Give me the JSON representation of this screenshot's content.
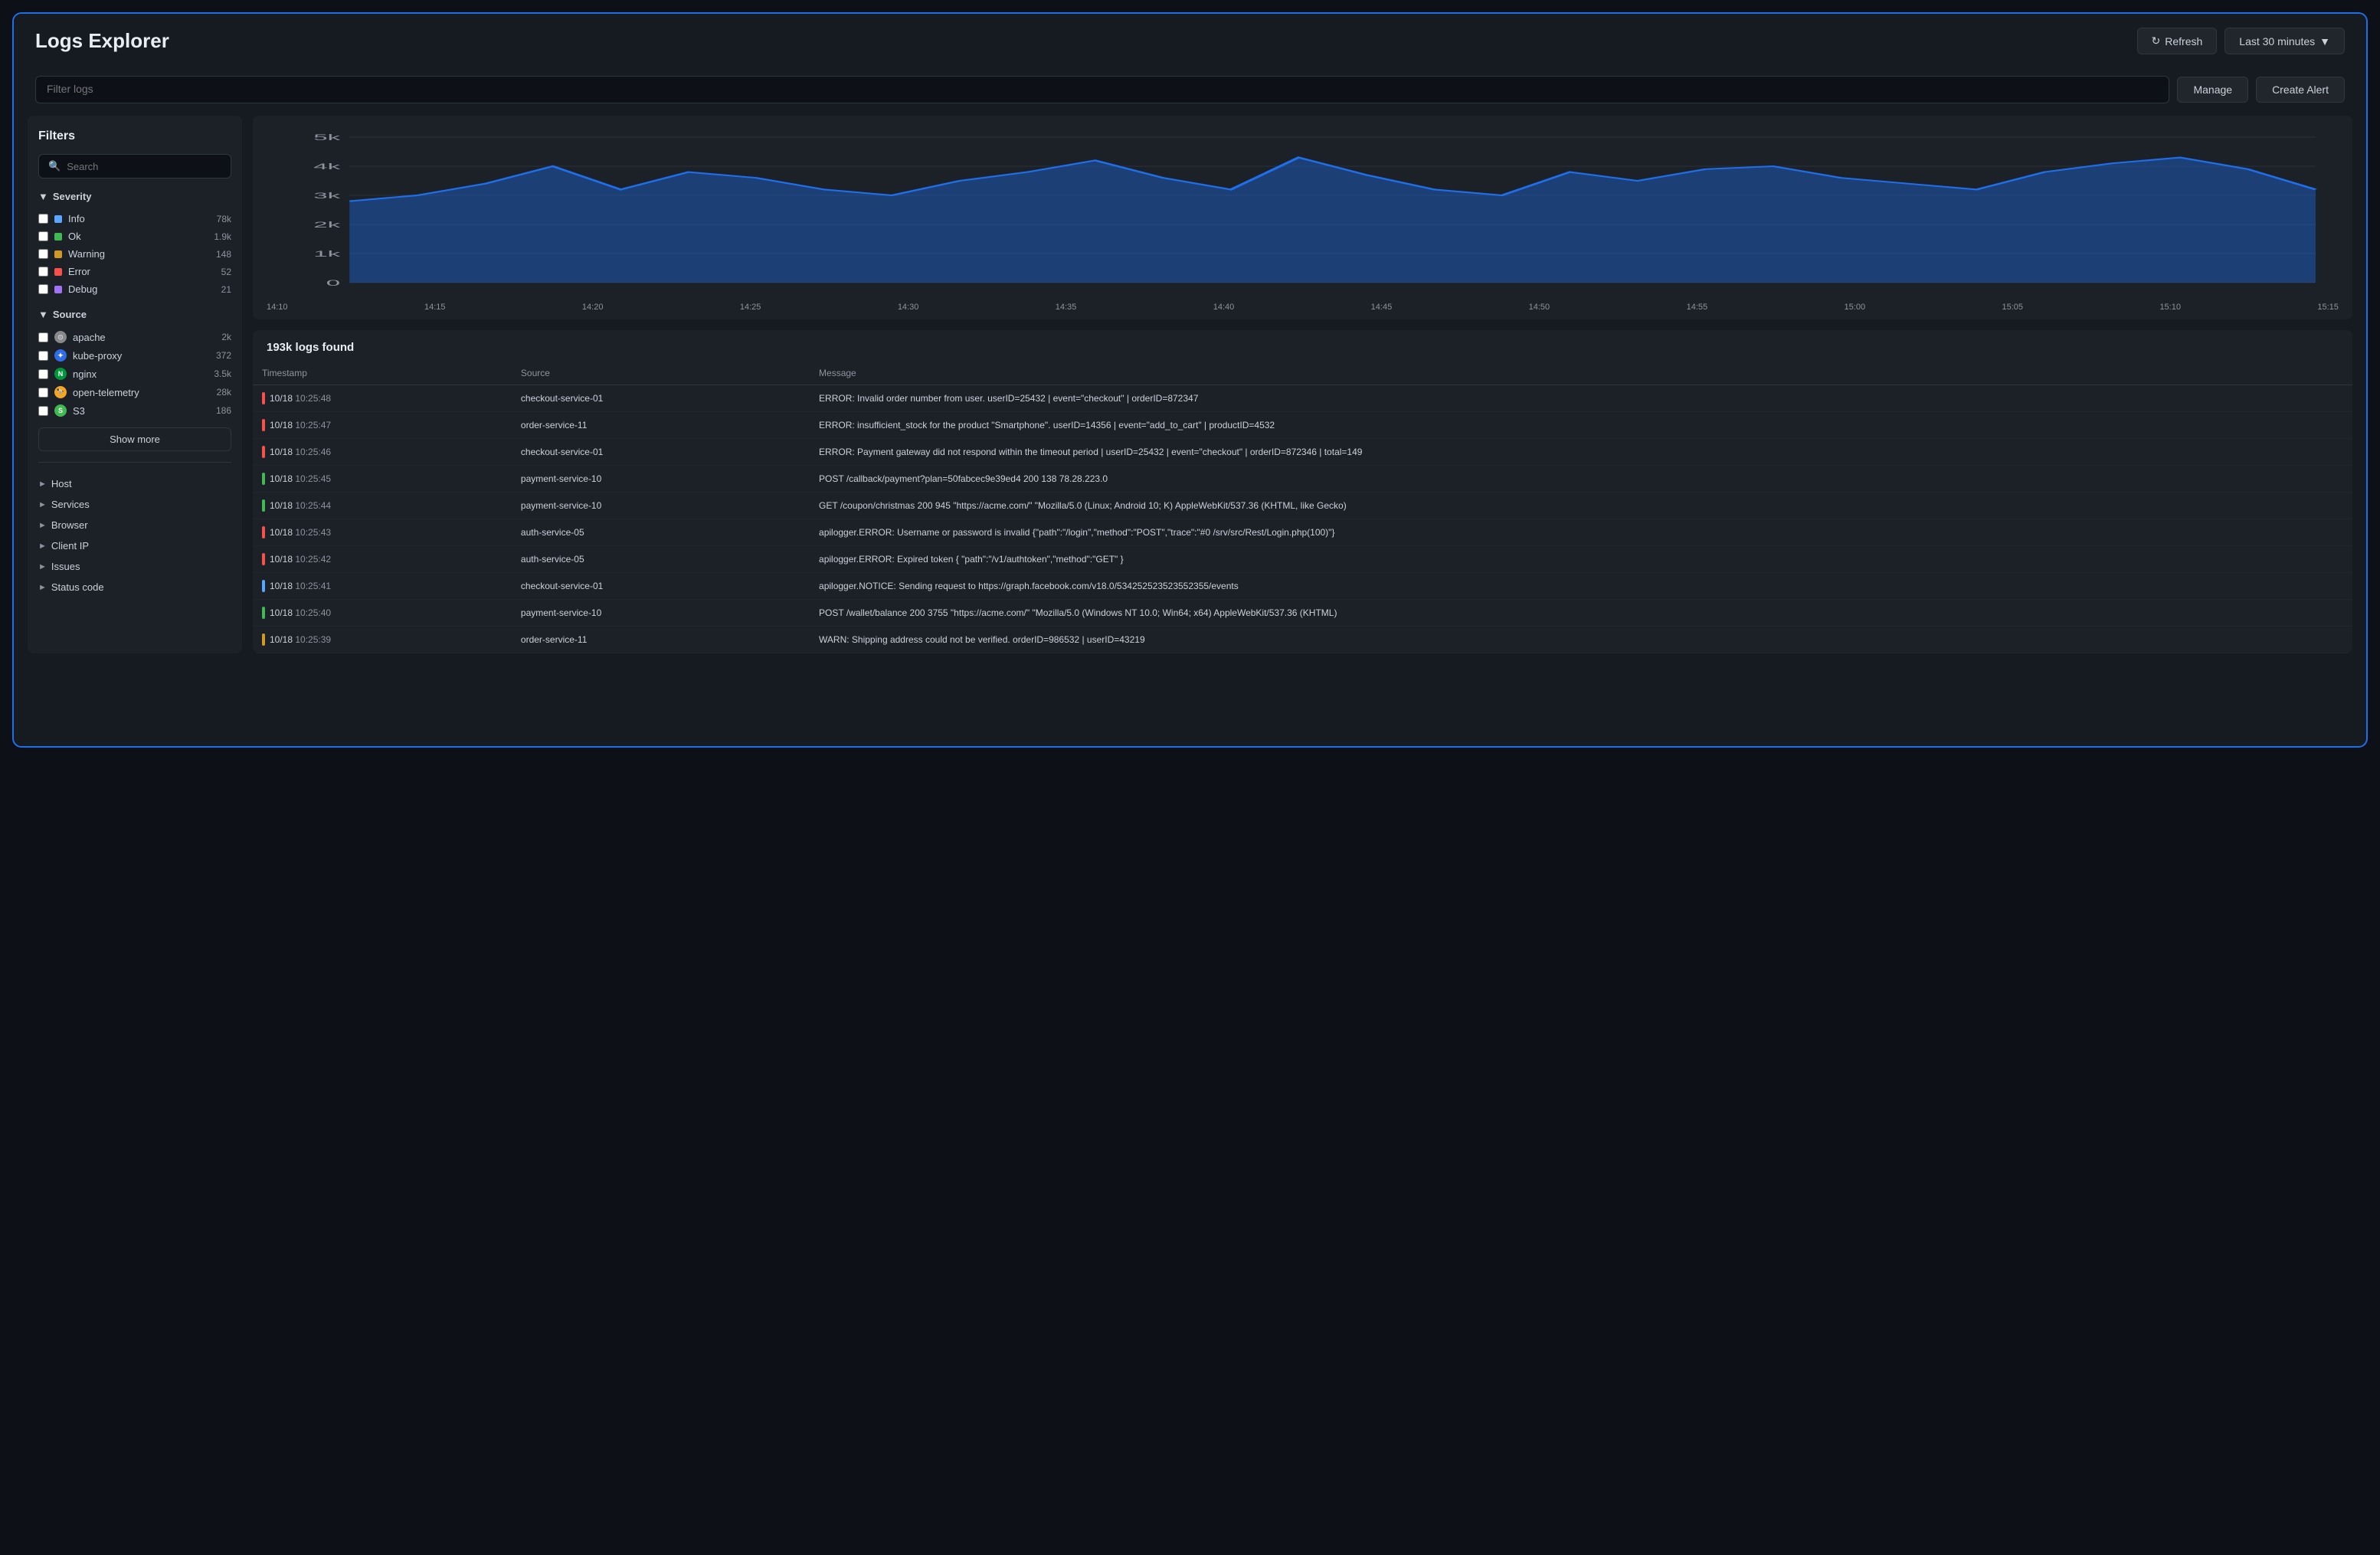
{
  "header": {
    "title": "Logs Explorer",
    "refresh_label": "Refresh",
    "time_range_label": "Last 30 minutes"
  },
  "filter_bar": {
    "placeholder": "Filter logs",
    "manage_label": "Manage",
    "create_alert_label": "Create Alert"
  },
  "sidebar": {
    "title": "Filters",
    "search_placeholder": "Search",
    "severity_section": "Severity",
    "severity_items": [
      {
        "name": "Info",
        "count": "78k",
        "color": "#58a6ff"
      },
      {
        "name": "Ok",
        "count": "1.9k",
        "color": "#3fb950"
      },
      {
        "name": "Warning",
        "count": "148",
        "color": "#d29922"
      },
      {
        "name": "Error",
        "count": "52",
        "color": "#f85149"
      },
      {
        "name": "Debug",
        "count": "21",
        "color": "#a371f7"
      }
    ],
    "source_section": "Source",
    "source_items": [
      {
        "name": "apache",
        "count": "2k",
        "icon_bg": "#888",
        "icon_label": "⊙",
        "icon_color": "#c9d1d9"
      },
      {
        "name": "kube-proxy",
        "count": "372",
        "icon_bg": "#326ce5",
        "icon_label": "✦",
        "icon_color": "#fff"
      },
      {
        "name": "nginx",
        "count": "3.5k",
        "icon_bg": "#009639",
        "icon_label": "N",
        "icon_color": "#fff"
      },
      {
        "name": "open-telemetry",
        "count": "28k",
        "icon_bg": "#f5a623",
        "icon_label": "🔭",
        "icon_color": "#fff"
      },
      {
        "name": "S3",
        "count": "186",
        "icon_bg": "#3fb950",
        "icon_label": "S",
        "icon_color": "#fff"
      }
    ],
    "show_more_label": "Show more",
    "collapsibles": [
      "Host",
      "Services",
      "Browser",
      "Client IP",
      "Issues",
      "Status code"
    ]
  },
  "chart": {
    "y_labels": [
      "5k",
      "4k",
      "3k",
      "2k",
      "1k",
      "0"
    ],
    "x_labels": [
      "14:10",
      "14:15",
      "14:20",
      "14:25",
      "14:30",
      "14:35",
      "14:40",
      "14:45",
      "14:50",
      "14:55",
      "15:00",
      "15:05",
      "15:10",
      "15:15"
    ]
  },
  "logs": {
    "count_label": "193k logs found",
    "columns": [
      "Timestamp",
      "Source",
      "Message"
    ],
    "rows": [
      {
        "date": "10/18",
        "time": "10:25:48",
        "source": "checkout-service-01",
        "level_color": "#f85149",
        "message": "ERROR: Invalid order number from user. userID=25432 | event=\"checkout\" | orderID=872347"
      },
      {
        "date": "10/18",
        "time": "10:25:47",
        "source": "order-service-11",
        "level_color": "#f85149",
        "message": "ERROR: insufficient_stock for the product \"Smartphone\". userID=14356 | event=\"add_to_cart\" | productID=4532"
      },
      {
        "date": "10/18",
        "time": "10:25:46",
        "source": "checkout-service-01",
        "level_color": "#f85149",
        "message": "ERROR: Payment gateway did not respond within the timeout period | userID=25432 | event=\"checkout\" | orderID=872346 | total=149"
      },
      {
        "date": "10/18",
        "time": "10:25:45",
        "source": "payment-service-10",
        "level_color": "#3fb950",
        "message": "POST /callback/payment?plan=50fabcec9e39ed4 200 138 78.28.223.0"
      },
      {
        "date": "10/18",
        "time": "10:25:44",
        "source": "payment-service-10",
        "level_color": "#3fb950",
        "message": "GET /coupon/christmas 200 945 \"https://acme.com/\" \"Mozilla/5.0 (Linux; Android 10; K) AppleWebKit/537.36 (KHTML, like Gecko)"
      },
      {
        "date": "10/18",
        "time": "10:25:43",
        "source": "auth-service-05",
        "level_color": "#f85149",
        "message": "apilogger.ERROR: Username or password is invalid {\"path\":\"/login\",\"method\":\"POST\",\"trace\":\"#0 /srv/src/Rest/Login.php(100)\"}"
      },
      {
        "date": "10/18",
        "time": "10:25:42",
        "source": "auth-service-05",
        "level_color": "#f85149",
        "message": "apilogger.ERROR: Expired token { \"path\":\"/v1/authtoken\",\"method\":\"GET\" }"
      },
      {
        "date": "10/18",
        "time": "10:25:41",
        "source": "checkout-service-01",
        "level_color": "#58a6ff",
        "message": "apilogger.NOTICE: Sending request to https://graph.facebook.com/v18.0/534252523523552355/events"
      },
      {
        "date": "10/18",
        "time": "10:25:40",
        "source": "payment-service-10",
        "level_color": "#3fb950",
        "message": "POST /wallet/balance 200 3755 \"https://acme.com/\" \"Mozilla/5.0 (Windows NT 10.0; Win64; x64) AppleWebKit/537.36 (KHTML)"
      },
      {
        "date": "10/18",
        "time": "10:25:39",
        "source": "order-service-11",
        "level_color": "#d29922",
        "message": "WARN: Shipping address could not be verified. orderID=986532 | userID=43219"
      }
    ]
  }
}
